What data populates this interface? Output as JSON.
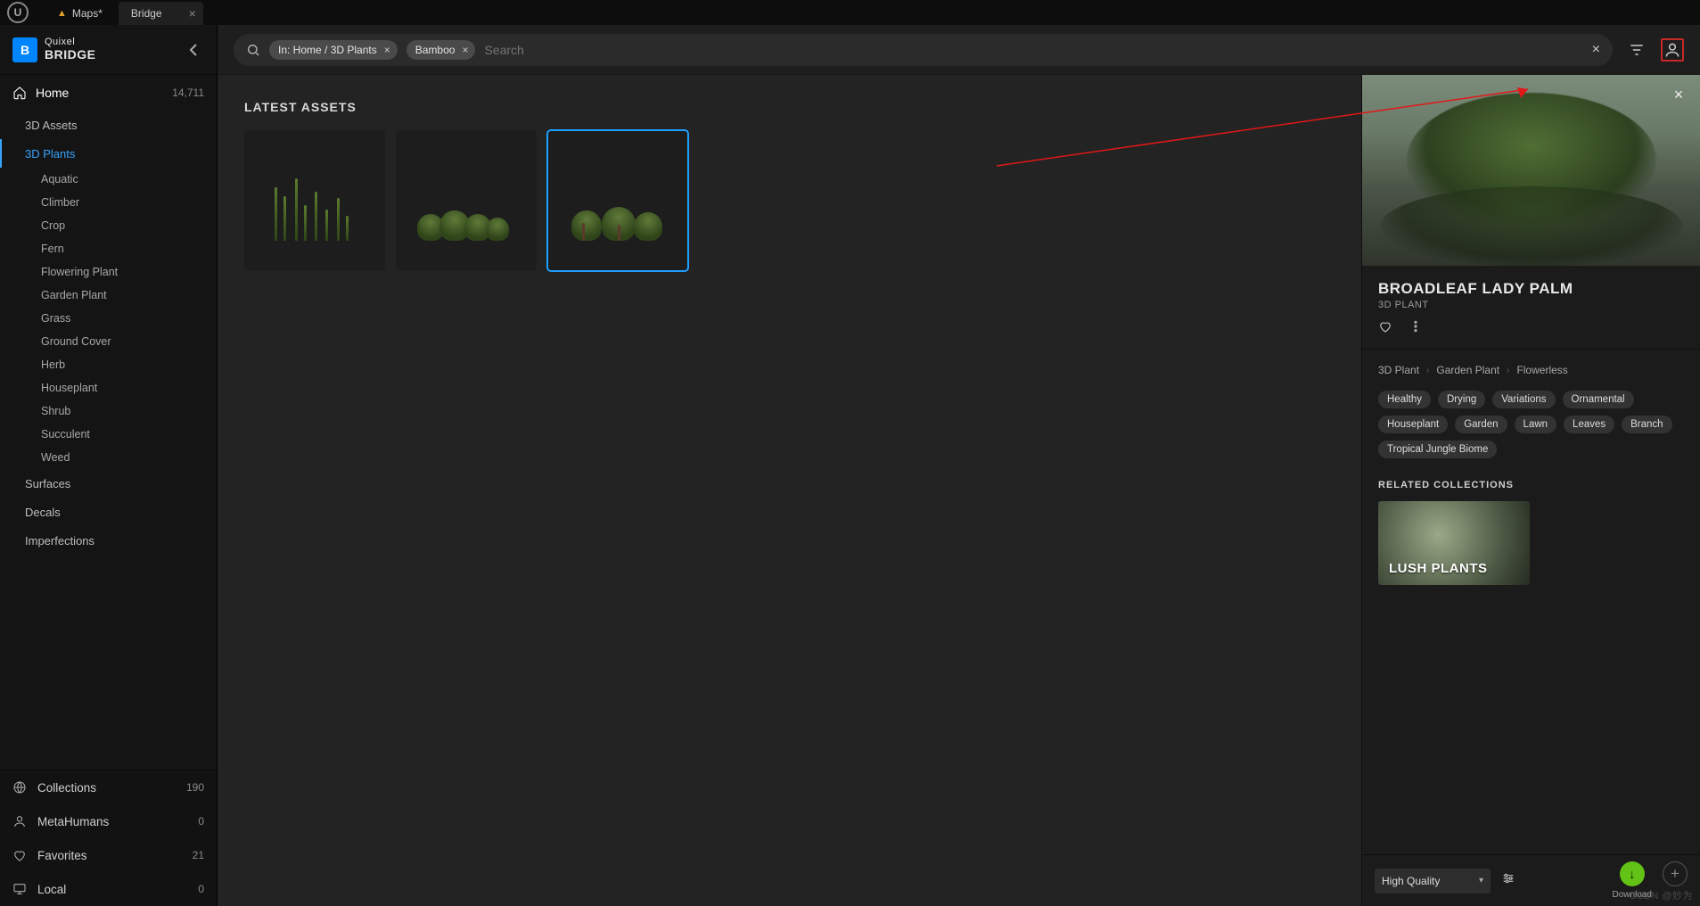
{
  "tabs": {
    "level": "Maps*",
    "bridge": "Bridge"
  },
  "brand": {
    "top": "Quixel",
    "bottom": "BRIDGE"
  },
  "sidebar": {
    "home": {
      "label": "Home",
      "count": "14,711"
    },
    "cats": [
      {
        "label": "3D Assets"
      },
      {
        "label": "3D Plants",
        "active": true,
        "children": [
          "Aquatic",
          "Climber",
          "Crop",
          "Fern",
          "Flowering Plant",
          "Garden Plant",
          "Grass",
          "Ground Cover",
          "Herb",
          "Houseplant",
          "Shrub",
          "Succulent",
          "Weed"
        ]
      },
      {
        "label": "Surfaces"
      },
      {
        "label": "Decals"
      },
      {
        "label": "Imperfections"
      }
    ],
    "bottom": [
      {
        "label": "Collections",
        "count": "190"
      },
      {
        "label": "MetaHumans",
        "count": "0"
      },
      {
        "label": "Favorites",
        "count": "21"
      },
      {
        "label": "Local",
        "count": "0"
      }
    ]
  },
  "search": {
    "chip_path": "In: Home / 3D Plants",
    "chip_term": "Bamboo",
    "placeholder": "Search"
  },
  "gallery": {
    "heading": "LATEST ASSETS"
  },
  "detail": {
    "title": "BROADLEAF LADY PALM",
    "subtitle": "3D PLANT",
    "crumbs": [
      "3D Plant",
      "Garden Plant",
      "Flowerless"
    ],
    "tags": [
      "Healthy",
      "Drying",
      "Variations",
      "Ornamental",
      "Houseplant",
      "Garden",
      "Lawn",
      "Leaves",
      "Branch",
      "Tropical Jungle Biome"
    ],
    "related_heading": "RELATED COLLECTIONS",
    "related_card": "LUSH PLANTS",
    "quality": "High Quality",
    "download": "Download"
  },
  "watermark": "CSDN @妙为"
}
